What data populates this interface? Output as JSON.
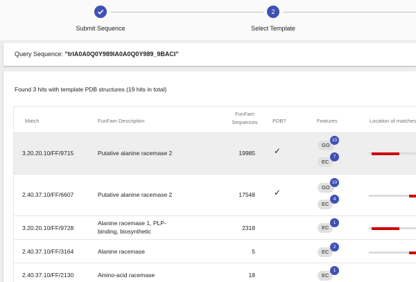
{
  "stepper": {
    "steps": [
      {
        "label": "Submit Sequence",
        "state": "completed",
        "icon": "check-icon"
      },
      {
        "label": "Select Template",
        "state": "active",
        "number": "2"
      }
    ]
  },
  "query": {
    "label": "Query Sequence:",
    "value": "\"trIA0A0Q0Y989IA0A0Q0Y989_9BACI\""
  },
  "results": {
    "summary": "Found 3 hits with template PDB structures (19 hits in total)",
    "columns": {
      "match": "Match",
      "description": "FunFam Description",
      "sequences_line1": "FunFam",
      "sequences_line2": "Sequences",
      "pdb": "PDB?",
      "features": "Features",
      "location": "Location of matches"
    },
    "rows": [
      {
        "match": "3.20.20.10/FF/9715",
        "description": "Putative alanine racemase 2",
        "sequences": "19985",
        "pdb": true,
        "go": "10",
        "ec": "7",
        "coverage": [
          0.06,
          0.6
        ]
      },
      {
        "match": "2.40.37.10/FF/6607",
        "description": "Putative alanine racemase 2",
        "sequences": "17548",
        "pdb": true,
        "go": "10",
        "ec": "4",
        "coverage": [
          0.78,
          1.0
        ]
      },
      {
        "match": "3.20.20.10/FF/9728",
        "description": "Alanine racemase 1, PLP-binding, biosynthetic",
        "sequences": "2318",
        "pdb": false,
        "go": null,
        "ec": "1",
        "coverage": [
          0.06,
          0.6
        ]
      },
      {
        "match": "2.40.37.10/FF/3164",
        "description": "Alanine racemase",
        "sequences": "5",
        "pdb": false,
        "go": null,
        "ec": "2",
        "coverage": [
          0.78,
          1.0
        ]
      },
      {
        "match": "2.40.37.10/FF/2130",
        "description": "Amino-acid racemase",
        "sequences": "18",
        "pdb": false,
        "go": null,
        "ec": "1",
        "coverage": [
          0.78,
          1.0
        ]
      }
    ],
    "feature_labels": {
      "go": "GO",
      "ec": "EC"
    },
    "check_glyph": "✓"
  },
  "colors": {
    "primary": "#3f51b5",
    "hit": "#cc0000",
    "track": "#dcdcdc"
  }
}
